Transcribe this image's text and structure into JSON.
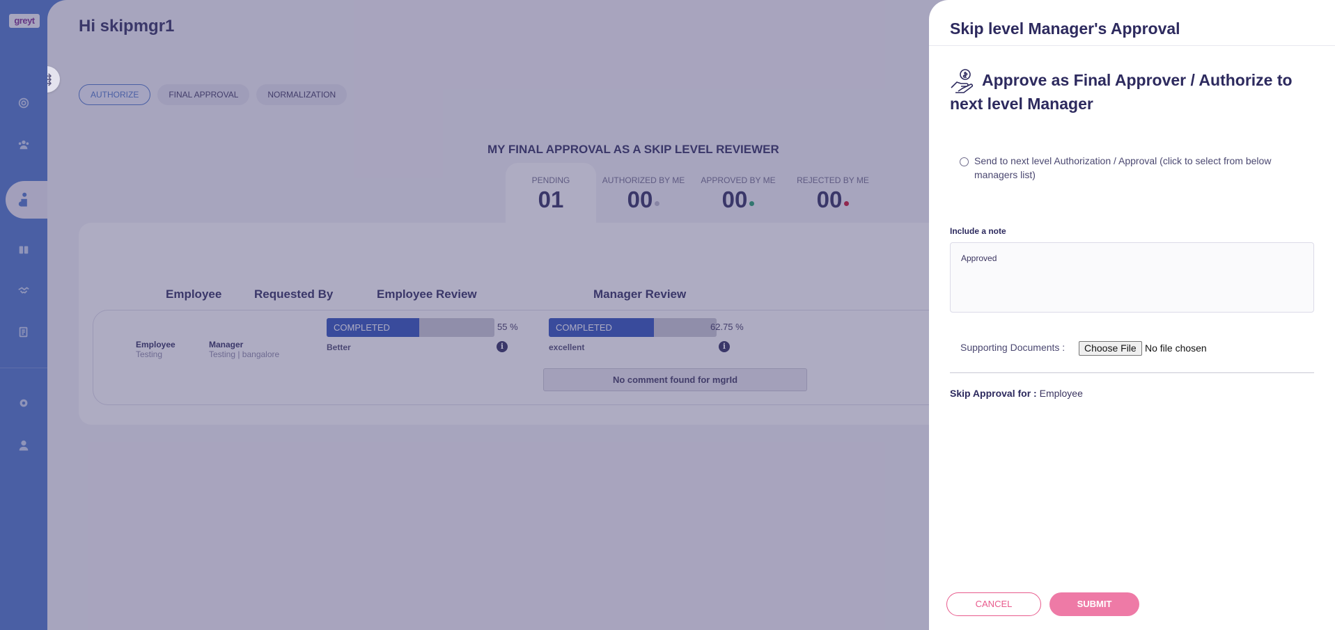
{
  "app": {
    "logo_text": "greyt"
  },
  "sidebar": {
    "items": [
      {
        "icon": "target-icon"
      },
      {
        "icon": "team-icon"
      },
      {
        "icon": "performance-icon",
        "active": true
      },
      {
        "icon": "book-icon"
      },
      {
        "icon": "handshake-icon"
      },
      {
        "icon": "report-icon"
      },
      {
        "icon": "settings-icon"
      },
      {
        "icon": "profile-icon"
      }
    ]
  },
  "header": {
    "greeting": "Hi skipmgr1"
  },
  "tabs": [
    {
      "label": "AUTHORIZE",
      "active": true
    },
    {
      "label": "FINAL APPROVAL"
    },
    {
      "label": "NORMALIZATION"
    }
  ],
  "summary": {
    "title": "MY FINAL APPROVAL AS A SKIP LEVEL REVIEWER",
    "stats": [
      {
        "label": "PENDING",
        "value": "01",
        "dot_color": ""
      },
      {
        "label": "AUTHORIZED BY ME",
        "value": "00",
        "dot_color": "#b9b7c9"
      },
      {
        "label": "APPROVED BY ME",
        "value": "00",
        "dot_color": "#1f9d6b"
      },
      {
        "label": "REJECTED BY ME",
        "value": "00",
        "dot_color": "#c8102e"
      }
    ]
  },
  "table": {
    "columns": [
      "Employee",
      "Requested By",
      "Employee Review",
      "Manager Review"
    ],
    "row": {
      "employee_name": "Employee",
      "employee_sub": "Testing",
      "requested_by_name": "Manager",
      "requested_by_sub": "Testing | bangalore",
      "employee_review": {
        "status": "COMPLETED",
        "progress": 0.55,
        "percent_text": "55 %",
        "rating": "Better"
      },
      "manager_review": {
        "status": "COMPLETED",
        "progress": 0.6275,
        "percent_text": "62.75 %",
        "rating": "excellent"
      },
      "comment": "No comment found for mgrId"
    }
  },
  "drawer": {
    "title": "Skip level Manager's Approval",
    "heading": "Approve as Final Approver / Authorize to next level Manager",
    "radio_label": "Send to next level Authorization / Approval (click to select from below managers list)",
    "note_label": "Include a note",
    "note_value": "Approved",
    "docs_label": "Supporting Documents :",
    "file_button": "Choose File",
    "file_name": "No file chosen",
    "skip_for_label": "Skip Approval for :",
    "skip_for_value": "Employee",
    "cancel_label": "CANCEL",
    "submit_label": "SUBMIT"
  },
  "colors": {
    "sidebar": "#4a74c8",
    "accent_blue": "#2a4fbb",
    "cancel": "#e85a8c",
    "submit": "#ee7aa6"
  }
}
